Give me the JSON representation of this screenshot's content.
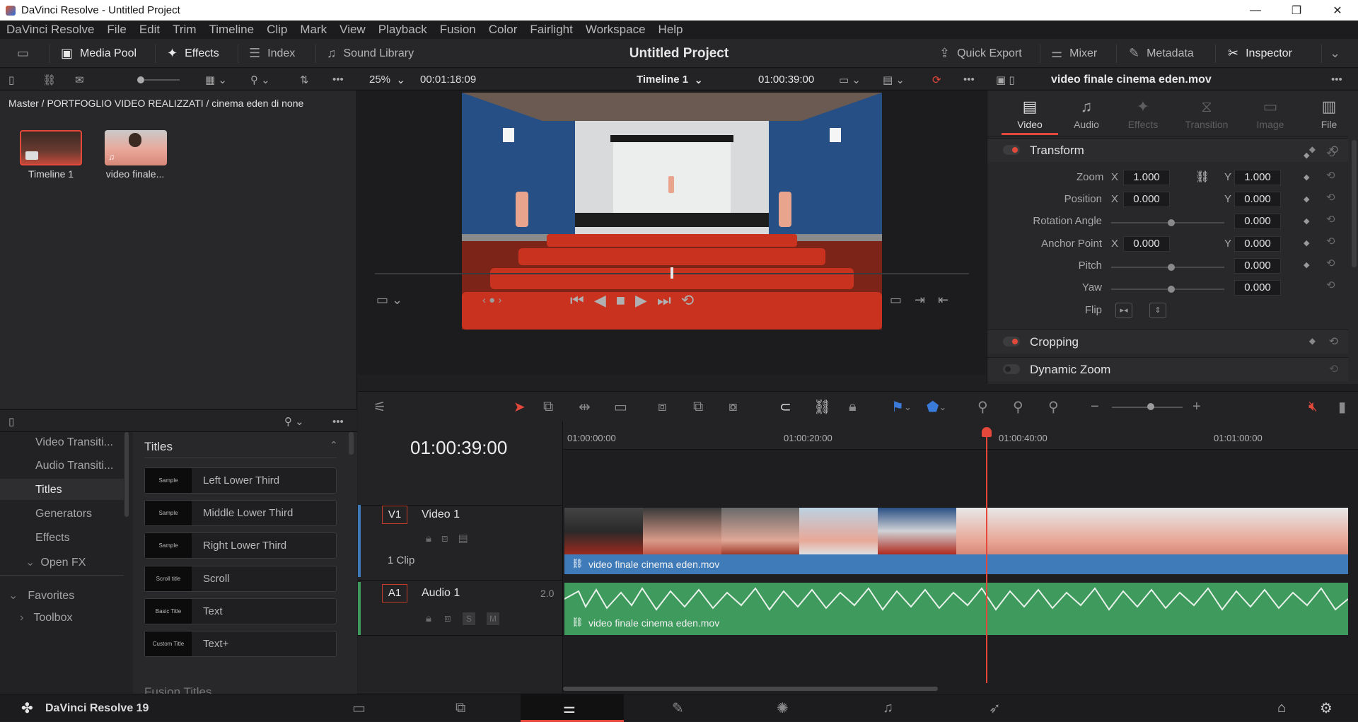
{
  "window": {
    "title": "DaVinci Resolve - Untitled Project"
  },
  "menu": [
    "DaVinci Resolve",
    "File",
    "Edit",
    "Trim",
    "Timeline",
    "Clip",
    "Mark",
    "View",
    "Playback",
    "Fusion",
    "Color",
    "Fairlight",
    "Workspace",
    "Help"
  ],
  "toolbar": {
    "media_pool": "Media Pool",
    "effects": "Effects",
    "index": "Index",
    "sound_library": "Sound Library",
    "project_title": "Untitled Project",
    "quick_export": "Quick Export",
    "mixer": "Mixer",
    "metadata": "Metadata",
    "inspector": "Inspector"
  },
  "viewer_bar": {
    "zoom": "25%",
    "source_tc": "00:01:18:09",
    "timeline_name": "Timeline 1",
    "record_tc": "01:00:39:00",
    "clip_name": "video finale cinema eden.mov"
  },
  "media_pool": {
    "breadcrumb": "Master / PORTFOGLIO VIDEO REALIZZATI / cinema eden di none",
    "items": [
      {
        "label": "Timeline 1"
      },
      {
        "label": "video finale..."
      }
    ]
  },
  "effects_panel": {
    "tree": [
      "Video Transiti...",
      "Audio Transiti...",
      "Titles",
      "Generators",
      "Effects",
      "Open FX",
      "Favorites",
      "Toolbox"
    ],
    "selected": "Titles",
    "section_title": "Titles",
    "titles": [
      "Left Lower Third",
      "Middle Lower Third",
      "Right Lower Third",
      "Scroll",
      "Text",
      "Text+"
    ],
    "next_section": "Fusion Titles",
    "preview_labels": [
      "Sample",
      "Sample",
      "Sample",
      "Scroll title",
      "Basic Title",
      "Custom Title"
    ]
  },
  "inspector": {
    "tabs": [
      "Video",
      "Audio",
      "Effects",
      "Transition",
      "Image",
      "File"
    ],
    "active_tab": "Video",
    "transform_label": "Transform",
    "zoom_label": "Zoom",
    "zoom_x": "1.000",
    "zoom_y": "1.000",
    "position_label": "Position",
    "position_x": "0.000",
    "position_y": "0.000",
    "rotation_label": "Rotation Angle",
    "rotation": "0.000",
    "anchor_label": "Anchor Point",
    "anchor_x": "0.000",
    "anchor_y": "0.000",
    "pitch_label": "Pitch",
    "pitch": "0.000",
    "yaw_label": "Yaw",
    "yaw": "0.000",
    "flip_label": "Flip",
    "x": "X",
    "y": "Y",
    "cropping_label": "Cropping",
    "dynamic_zoom_label": "Dynamic Zoom"
  },
  "timeline": {
    "timecode": "01:00:39:00",
    "ruler": [
      "01:00:00:00",
      "01:00:20:00",
      "01:00:40:00",
      "01:01:00:00"
    ],
    "video_track": {
      "id": "V1",
      "name": "Video 1",
      "info": "1 Clip",
      "clip": "video finale cinema eden.mov"
    },
    "audio_track": {
      "id": "A1",
      "name": "Audio 1",
      "channels": "2.0",
      "clip": "video finale cinema eden.mov",
      "solo": "S",
      "mute": "M"
    }
  },
  "bottom": {
    "app": "DaVinci Resolve 19"
  },
  "colors": {
    "accent": "#e3483a",
    "video_clip": "#3f7bb8",
    "audio_clip": "#3f9a5e",
    "inspector_tab_active": "#e3483a"
  }
}
